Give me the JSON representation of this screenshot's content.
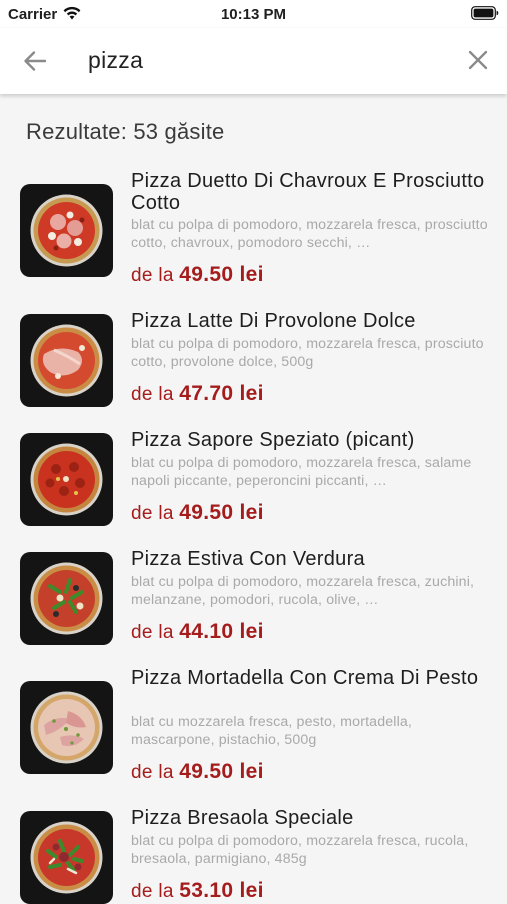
{
  "status_bar": {
    "carrier": "Carrier",
    "time": "10:13 PM"
  },
  "search": {
    "query": "pizza"
  },
  "results": {
    "count_label": "Rezultate: 53 găsite"
  },
  "price_prefix": "de la",
  "items": [
    {
      "name": "Pizza Duetto Di Chavroux E Prosciutto Cotto",
      "description": "blat cu polpa di pomodoro, mozzarela fresca, prosciutto cotto, chavroux, pomodoro secchi, …",
      "price": "49.50 lei"
    },
    {
      "name": "Pizza Latte Di Provolone Dolce",
      "description": "blat cu polpa di pomodoro, mozzarela fresca, prosciuto cotto, provolone dolce, 500g",
      "price": "47.70 lei"
    },
    {
      "name": "Pizza Sapore Speziato (picant)",
      "description": "blat cu polpa di pomodoro, mozzarela fresca, salame napoli piccante, peperoncini piccanti, …",
      "price": "49.50 lei"
    },
    {
      "name": "Pizza Estiva Con Verdura",
      "description": "blat cu polpa di pomodoro, mozzarela fresca, zuchini, melanzane, pomodori, rucola, olive, …",
      "price": "44.10 lei"
    },
    {
      "name": "Pizza Mortadella Con Crema Di Pesto",
      "description": "blat cu mozzarela fresca, pesto, mortadella, mascarpone, pistachio, 500g",
      "price": "49.50 lei"
    },
    {
      "name": "Pizza Bresaola Speciale",
      "description": "blat cu polpa di pomodoro, mozzarela fresca, rucola, bresaola, parmigiano, 485g",
      "price": "53.10 lei"
    }
  ],
  "icons": {
    "back": "arrow-left-icon",
    "clear": "close-icon",
    "wifi": "wifi-icon",
    "battery": "battery-icon"
  },
  "colors": {
    "price": "#a51c1c",
    "description": "#a9a9a9",
    "background": "#f5f5f5"
  }
}
